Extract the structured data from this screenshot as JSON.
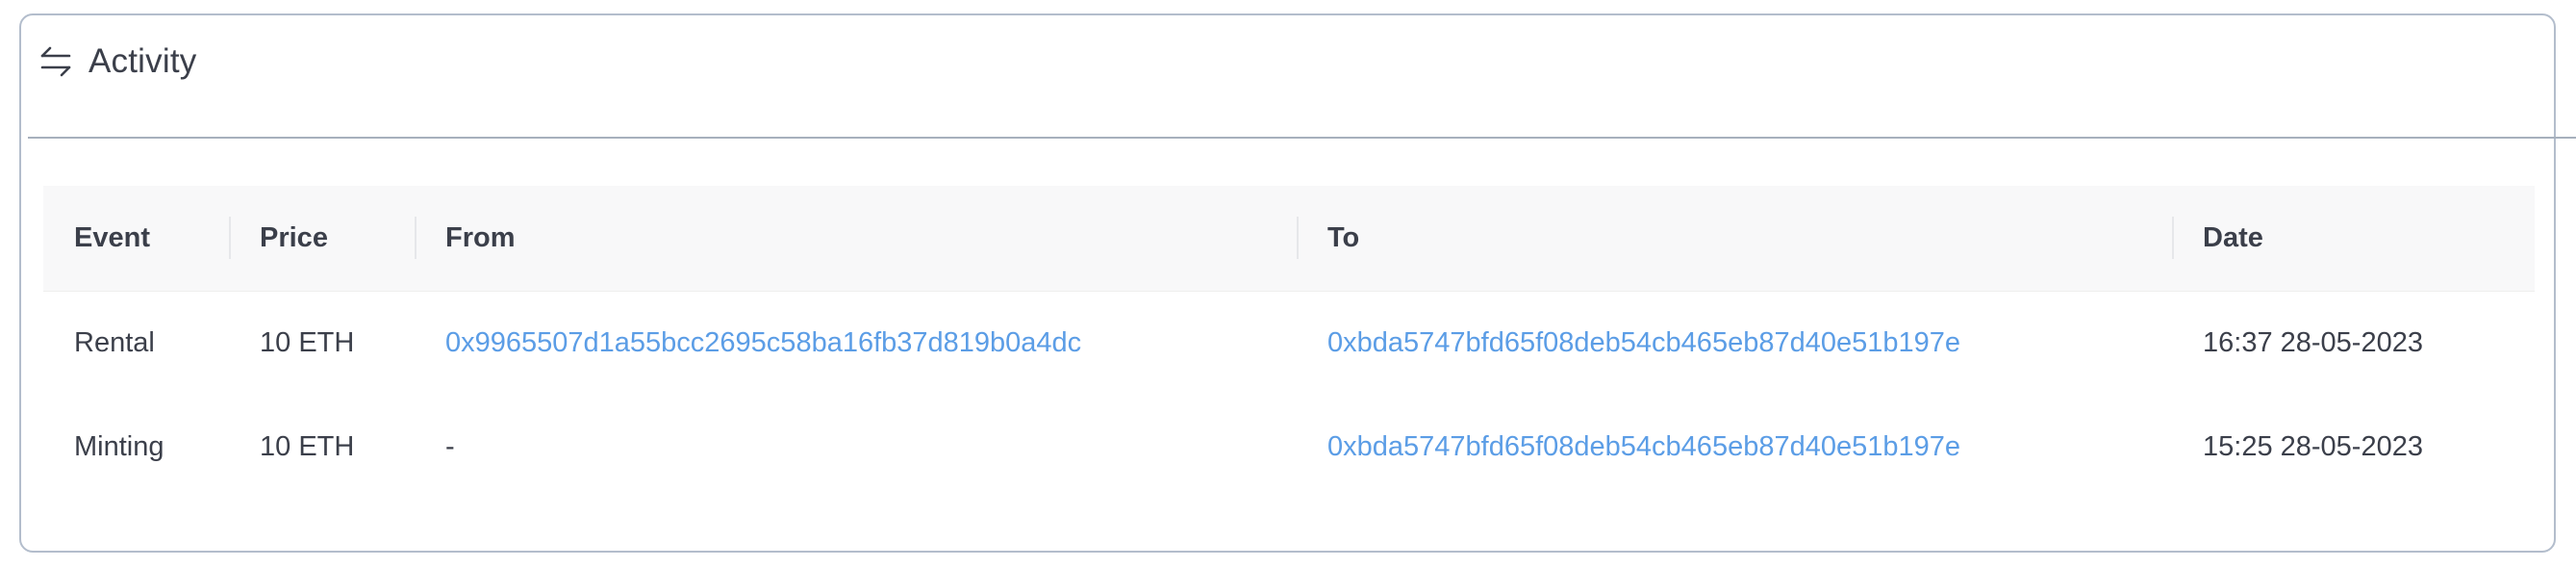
{
  "panel": {
    "title": "Activity",
    "icon": "arrows-swap-icon"
  },
  "table": {
    "columns": [
      "Event",
      "Price",
      "From",
      "To",
      "Date"
    ],
    "rows": [
      {
        "event": "Rental",
        "price": "10 ETH",
        "from": "0x9965507d1a55bcc2695c58ba16fb37d819b0a4dc",
        "to": "0xbda5747bfd65f08deb54cb465eb87d40e51b197e",
        "date": "16:37 28-05-2023"
      },
      {
        "event": "Minting",
        "price": "10 ETH",
        "from": "-",
        "to": "0xbda5747bfd65f08deb54cb465eb87d40e51b197e",
        "date": "15:25 28-05-2023"
      }
    ]
  },
  "colors": {
    "link": "#5b9de6",
    "text": "#3b3f4a",
    "border": "#b3bdcc",
    "header_bg": "#f8f8f9"
  }
}
